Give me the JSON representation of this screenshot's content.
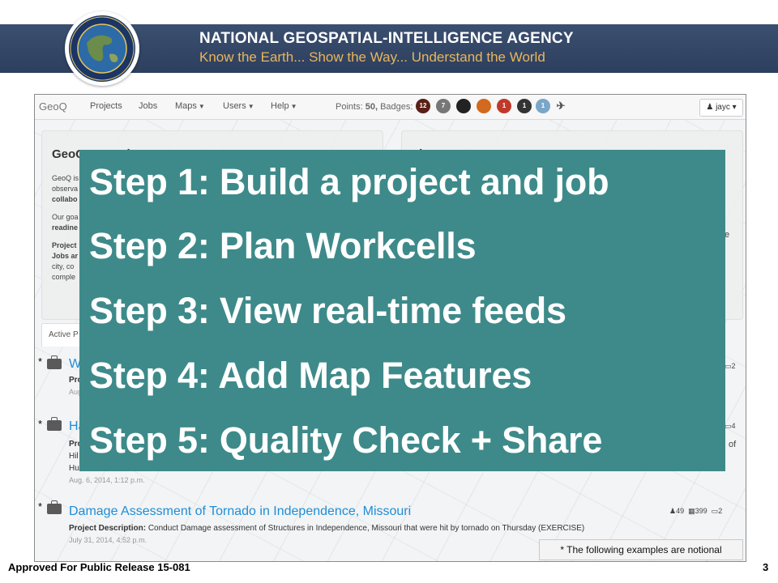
{
  "slide_header": {
    "title": "NATIONAL GEOSPATIAL-INTELLIGENCE AGENCY",
    "subtitle": "Know the Earth... Show the Way... Understand the World",
    "banner_color": "#33466a",
    "subtitle_color": "#e8b65c"
  },
  "app": {
    "brand": "GeoQ",
    "nav": [
      {
        "label": "Projects",
        "has_caret": false
      },
      {
        "label": "Jobs",
        "has_caret": false
      },
      {
        "label": "Maps",
        "has_caret": true
      },
      {
        "label": "Users",
        "has_caret": true
      },
      {
        "label": "Help",
        "has_caret": true
      }
    ],
    "points_label": "Points:",
    "points_value": "50,",
    "badges_label": "Badges:",
    "badges": [
      {
        "text": "12",
        "color": "#5a1f17",
        "icon": "badge-count"
      },
      {
        "text": "7",
        "color": "#777777",
        "icon": "badge-count"
      },
      {
        "text": "",
        "color": "#222222",
        "icon": "medal-icon"
      },
      {
        "text": "",
        "color": "#d2691e",
        "icon": "medal-icon"
      },
      {
        "text": "1",
        "color": "#c0392b",
        "icon": "badge-count"
      },
      {
        "text": "1",
        "color": "#333333",
        "icon": "badge-count"
      },
      {
        "text": "1",
        "color": "#7aa6c8",
        "icon": "badge-count"
      },
      {
        "text": "",
        "color": "#555555",
        "icon": "helicopter-icon"
      }
    ],
    "user_menu": "jayc",
    "left_panel": {
      "title": "GeoQ: Crowd",
      "lines": [
        "GeoQ is",
        "observa",
        "collabo",
        "Our goa",
        "readine",
        "Project",
        "Jobs ar",
        "city, co",
        "comple"
      ]
    },
    "right_panel": {
      "title": "Th",
      "right_fragment": "e"
    },
    "active_tab": "Active P",
    "list_items": [
      {
        "title_fragment": "W",
        "desc_fragment": "Pro",
        "date_fragment": "Aug",
        "stats_comments": "2"
      },
      {
        "title_fragment": "Ha",
        "desc_fragment": "Pro",
        "extra_lines": [
          "Hil",
          "Hu"
        ],
        "date": "Aug. 6, 2014, 1:12 p.m.",
        "stats_comments": "4",
        "right_fragment": "of"
      },
      {
        "title": "Damage Assessment of Tornado in Independence, Missouri",
        "desc_label": "Project Description:",
        "desc": "Conduct Damage assessment of Structures in Independence, Missouri that were hit by tornado on Thursday (EXERCISE)",
        "date": "July 31, 2014, 4:52 p.m.",
        "stats_users": "49",
        "stats_cells": "399",
        "stats_comments": "2"
      }
    ],
    "asterisk": "*"
  },
  "overlay": {
    "background": "#3e8a8a",
    "steps": [
      "Step 1: Build a project and job",
      "Step 2: Plan Workcells",
      "Step 3: View real-time feeds",
      "Step 4: Add Map Features",
      "Step 5: Quality Check + Share"
    ]
  },
  "note": "* The following examples are notional",
  "footer": {
    "release": "Approved For Public Release 15-081",
    "page_number": "3"
  }
}
